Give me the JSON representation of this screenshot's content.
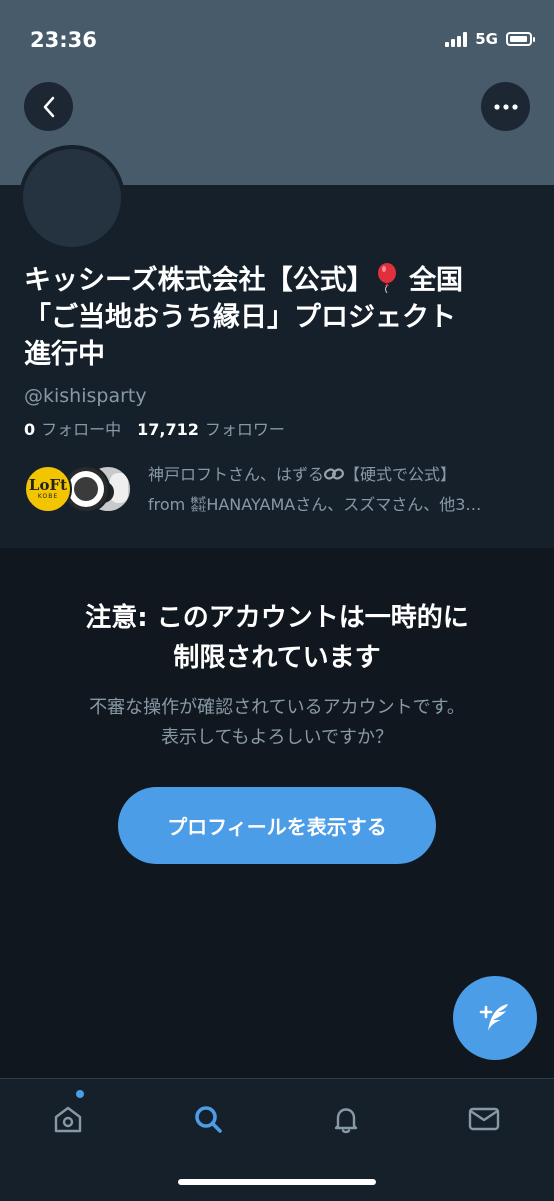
{
  "status_bar": {
    "time": "23:36",
    "network": "5G"
  },
  "profile": {
    "name_line1": "キッシーズ株式会社【公式】",
    "name_line1_end": "全国",
    "name_line2": "「ご当地おうち縁日」プロジェクト",
    "name_line3": "進行中",
    "handle": "@kishisparty",
    "following_count": "0",
    "following_label": "フォロー中",
    "followers_count": "17,712",
    "followers_label": "フォロワー",
    "followed_by_line1_a": "神戸ロフトさん、はずる",
    "followed_by_line1_b": "【硬式で公式】",
    "followed_by_line2": "from ㍿HANAYAMAさん、スズマさん、他3…",
    "loft_logo_text": "LoFt",
    "loft_logo_sub": "KOBE"
  },
  "warning": {
    "title_line1": "注意: このアカウントは一時的に",
    "title_line2": "制限されています",
    "subtitle_line1": "不審な操作が確認されているアカウントです。",
    "subtitle_line2": "表示してもよろしいですか？",
    "button_label": "プロフィールを表示する"
  },
  "colors": {
    "accent": "#4a9de6",
    "background": "#15202b",
    "banner": "#485b6b"
  },
  "tabbar": {
    "items": [
      "home-icon",
      "search-icon",
      "bell-icon",
      "mail-icon"
    ]
  }
}
